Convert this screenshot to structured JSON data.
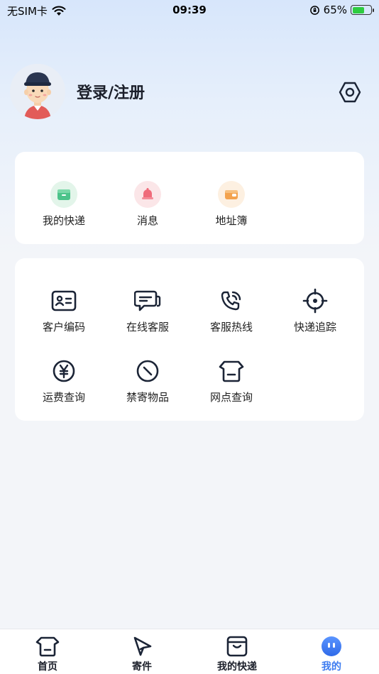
{
  "status_bar": {
    "carrier": "无SIM卡",
    "time": "09:39",
    "battery": "65%",
    "battery_level": 0.65
  },
  "profile": {
    "login_label": "登录/注册"
  },
  "quick_links": [
    {
      "label": "我的快递",
      "icon": "express-box-icon",
      "color": "#4cc38a"
    },
    {
      "label": "消息",
      "icon": "bell-icon",
      "color": "#ef6b7a"
    },
    {
      "label": "地址簿",
      "icon": "wallet-icon",
      "color": "#f3a24d"
    }
  ],
  "services": [
    {
      "label": "客户编码",
      "icon": "id-card-icon"
    },
    {
      "label": "在线客服",
      "icon": "chat-bubble-icon"
    },
    {
      "label": "客服热线",
      "icon": "phone-call-icon"
    },
    {
      "label": "快递追踪",
      "icon": "target-icon"
    },
    {
      "label": "运费查询",
      "icon": "yen-coin-icon"
    },
    {
      "label": "禁寄物品",
      "icon": "prohibited-icon"
    },
    {
      "label": "网点查询",
      "icon": "shop-icon"
    }
  ],
  "tabbar": [
    {
      "label": "首页",
      "icon": "home-box-icon"
    },
    {
      "label": "寄件",
      "icon": "send-arrow-icon"
    },
    {
      "label": "我的快递",
      "icon": "package-icon"
    },
    {
      "label": "我的",
      "icon": "face-icon",
      "active": true
    }
  ],
  "colors": {
    "accent": "#3d7cf0",
    "icon_stroke": "#1b2436"
  }
}
